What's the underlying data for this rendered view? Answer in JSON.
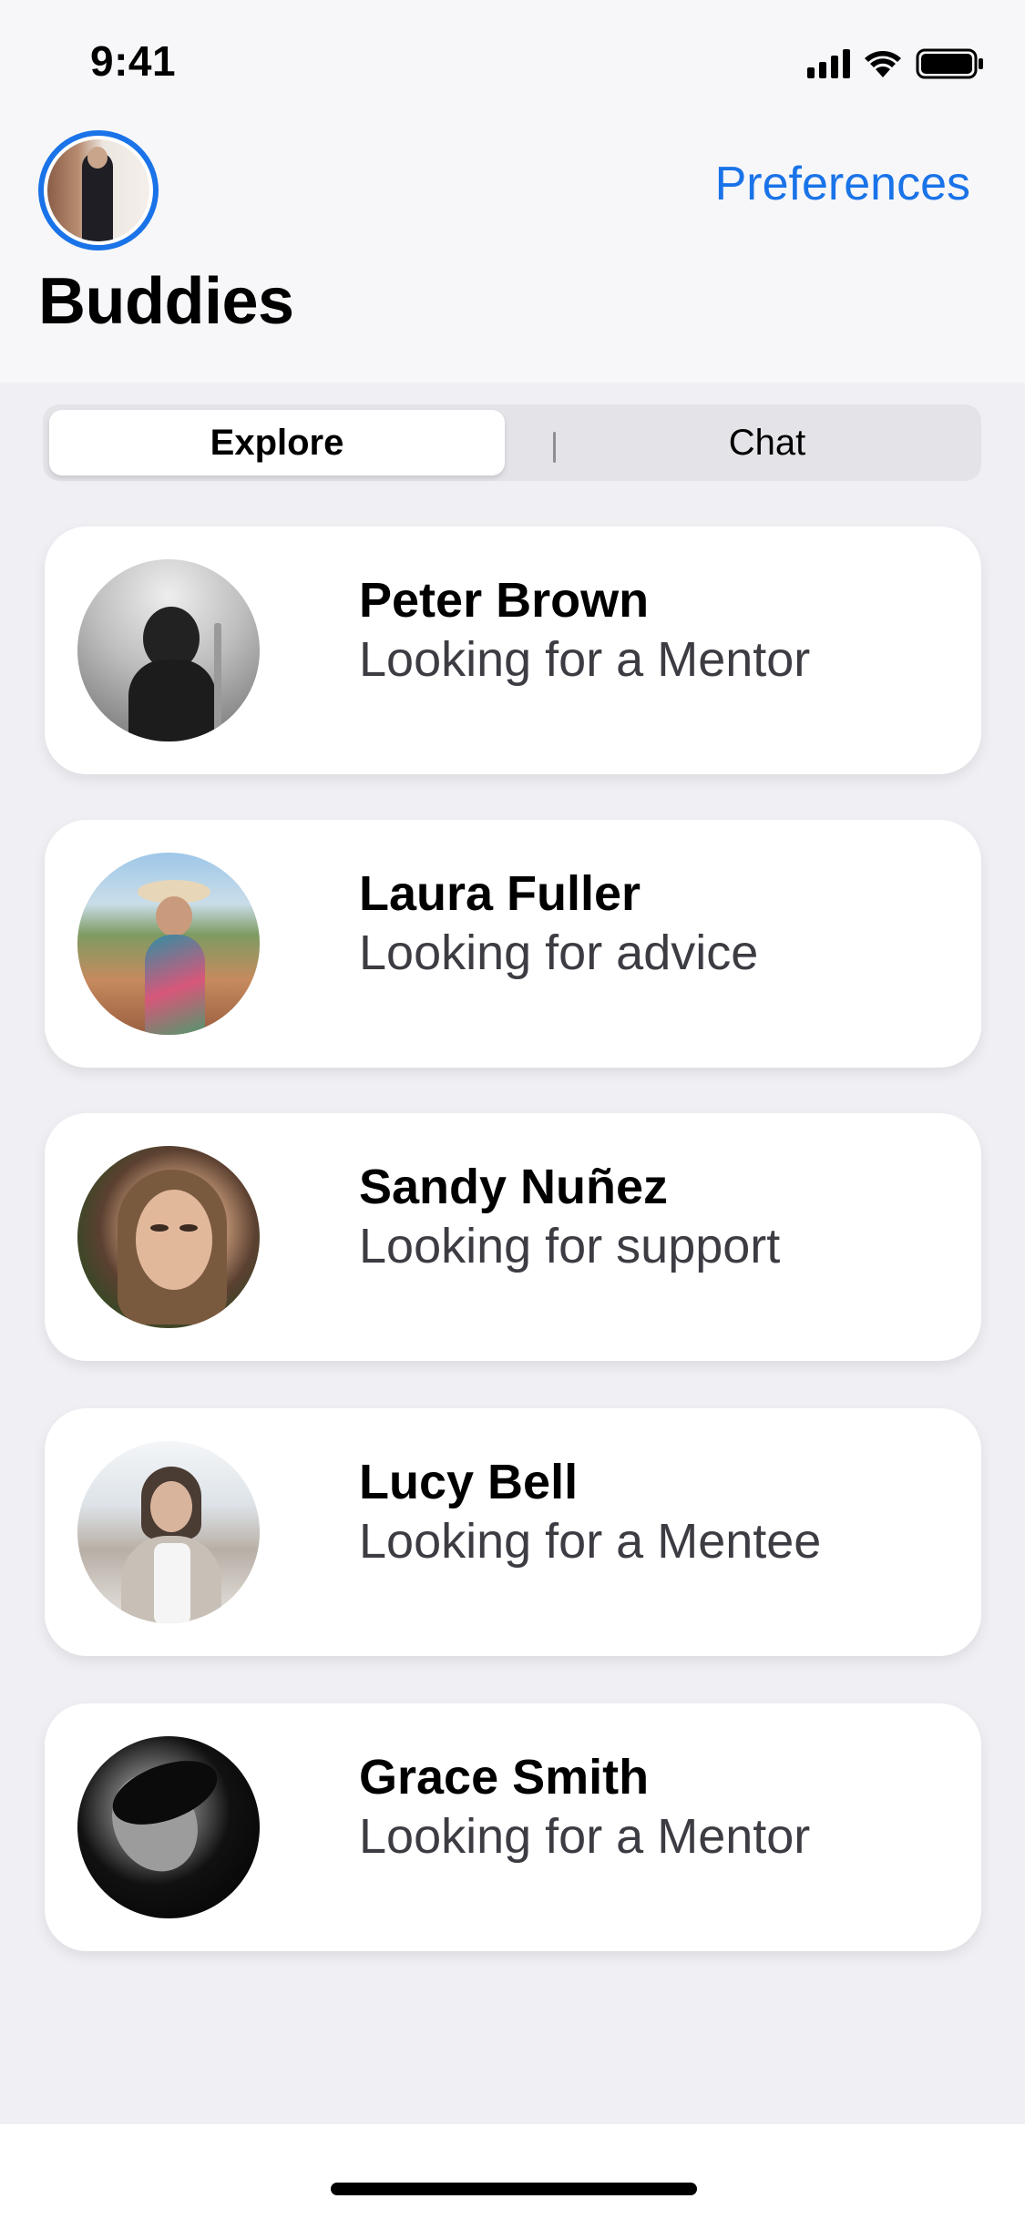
{
  "status_bar": {
    "time": "9:41"
  },
  "header": {
    "title": "Buddies",
    "preferences_label": "Preferences"
  },
  "segmented": {
    "explore_label": "Explore",
    "chat_label": "Chat",
    "selected": "Explore"
  },
  "buddies": [
    {
      "name": "Peter Brown",
      "status": "Looking for a Mentor"
    },
    {
      "name": "Laura Fuller",
      "status": "Looking for advice"
    },
    {
      "name": "Sandy Nuñez",
      "status": "Looking for support"
    },
    {
      "name": "Lucy Bell",
      "status": "Looking for a Mentee"
    },
    {
      "name": "Grace Smith",
      "status": "Looking for a Mentor"
    }
  ],
  "colors": {
    "accent": "#1A73E8",
    "background": "#EFEFF4",
    "card": "#FFFFFF",
    "secondary_text": "#3C3C43"
  }
}
